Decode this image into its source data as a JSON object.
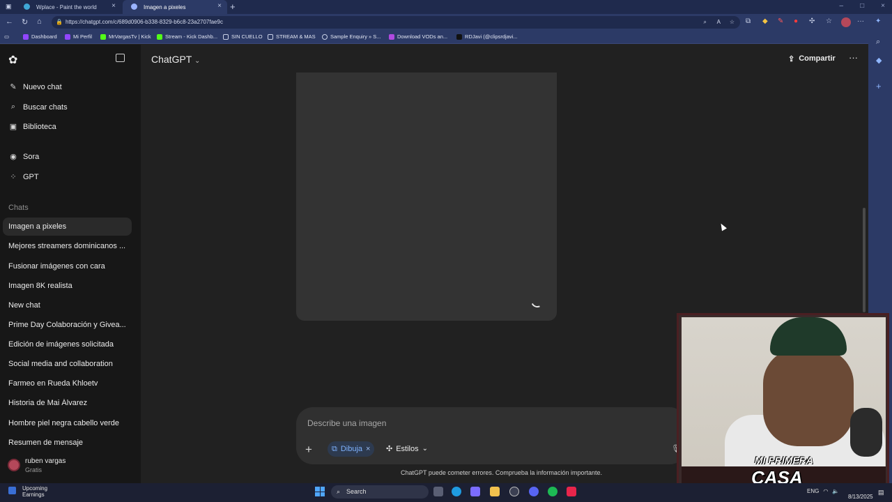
{
  "browser": {
    "tabs": [
      {
        "label": "Wplace - Paint the world",
        "icon_color": "#3fa7d6"
      },
      {
        "label": "Imagen a pixeles",
        "icon_color": "#9ab3ff"
      }
    ],
    "new_tab": "+",
    "url": "https://chatgpt.com/c/689d0906-b338-8329-b6c8-23a2707fae9c",
    "bookmarks": [
      {
        "label": "Dashboard",
        "color": "#9146ff"
      },
      {
        "label": "Mi Perfil",
        "color": "#9146ff"
      },
      {
        "label": "MrVargasTv | Kick",
        "color": "#53fc18"
      },
      {
        "label": "Stream - Kick Dashb...",
        "color": "#53fc18"
      },
      {
        "label": "SIN CUELLO",
        "color": "#c8d0e6"
      },
      {
        "label": "STREAM & MAS",
        "color": "#c8d0e6"
      },
      {
        "label": "Sample Enquiry » S...",
        "color": "#c8d0e6"
      },
      {
        "label": "Download VODs an...",
        "color": "#b04adf"
      },
      {
        "label": "RDJavi (@clipsrdjavi...",
        "color": "#111111"
      }
    ]
  },
  "sidebar": {
    "actions": [
      {
        "label": "Nuevo chat",
        "icon": "edit-icon"
      },
      {
        "label": "Buscar chats",
        "icon": "search-icon"
      },
      {
        "label": "Biblioteca",
        "icon": "library-icon"
      }
    ],
    "apps": [
      {
        "label": "Sora",
        "icon": "sora-icon"
      },
      {
        "label": "GPT",
        "icon": "grid-icon"
      }
    ],
    "section_title": "Chats",
    "chats": [
      "Imagen a pixeles",
      "Mejores streamers dominicanos ...",
      "Fusionar imágenes con cara",
      "Imagen 8K realista",
      "New chat",
      "Prime Day Colaboración y Givea...",
      "Edición de imágenes solicitada",
      "Social media and collaboration",
      "Farmeo en Rueda Khloetv",
      "Historia de Mai Álvarez",
      "Hombre piel negra cabello verde",
      "Resumen de mensaje"
    ],
    "user": {
      "name": "ruben vargas",
      "plan": "Gratis"
    }
  },
  "header": {
    "model": "ChatGPT",
    "share": "Compartir",
    "more": "···"
  },
  "composer": {
    "placeholder": "Describe una imagen",
    "tool_chip": "Dibuja",
    "styles": "Estilos"
  },
  "disclaimer": "ChatGPT puede cometer errores. Comprueba la información importante.",
  "overlay": {
    "logo_line1": "MI PRIMERA",
    "logo_line2": "CASA"
  },
  "taskbar": {
    "weather_title": "Upcoming",
    "weather_sub": "Earnings",
    "search": "Search",
    "lang": "ENG",
    "date": "8/13/2025"
  }
}
